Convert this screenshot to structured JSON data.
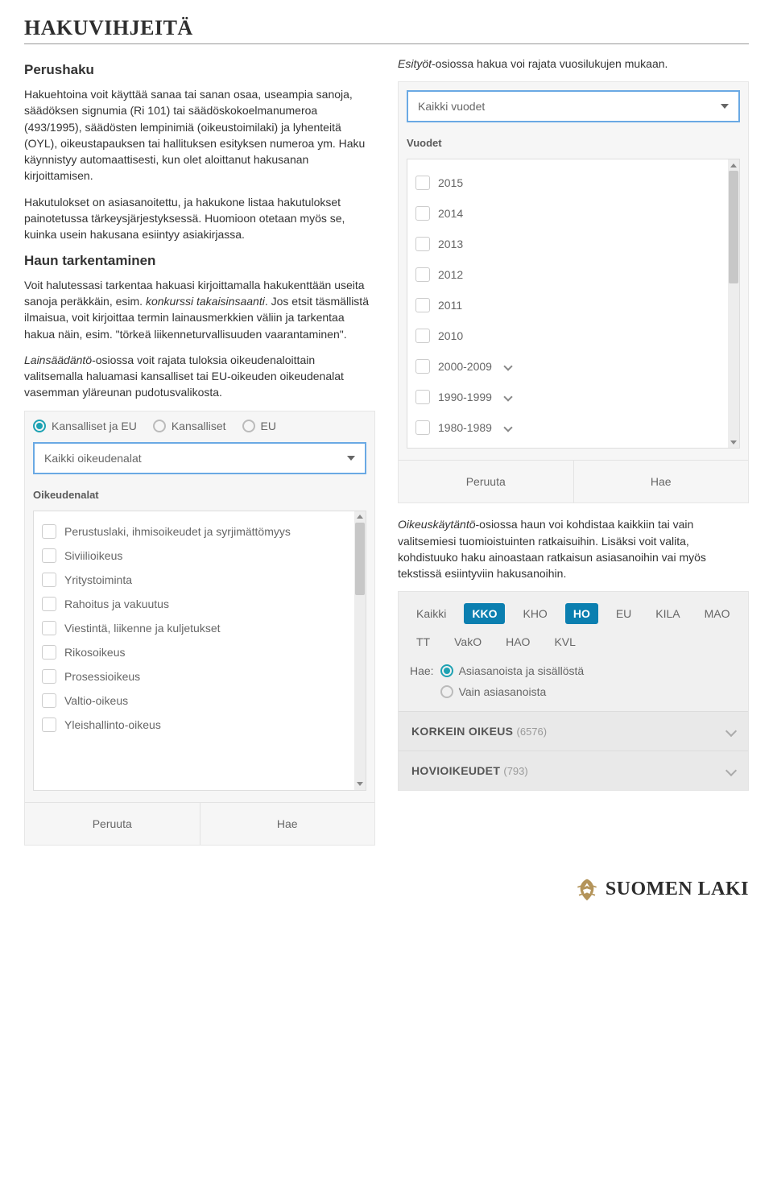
{
  "page_title": "HAKUVIHJEITÄ",
  "left": {
    "h_perushaku": "Perushaku",
    "p1": "Hakuehtoina voit käyttää sanaa tai sanan osaa, useampia sanoja, säädöksen signumia (Ri 101) tai säädöskokoelmanumeroa (493/1995), säädösten lempinimiä (oikeustoimilaki) ja lyhenteitä (OYL), oikeustapauksen tai hallituksen esityksen numeroa ym. Haku käynnistyy automaattisesti, kun olet aloittanut hakusanan kirjoittamisen.",
    "p2": "Hakutulokset on asiasanoitettu, ja hakukone listaa hakutulokset painotetussa tärkeysjärjestyksessä. Huomioon otetaan myös se, kuinka usein hakusana esiintyy asiakirjassa.",
    "h_tarkentaminen": "Haun tarkentaminen",
    "p3a": "Voit halutessasi tarkentaa hakuasi kirjoittamalla hakukenttään useita sanoja peräkkäin, esim. ",
    "p3b_italic": "konkurssi takaisinsaanti",
    "p3c": ". Jos etsit täsmällistä ilmaisua, voit kirjoittaa termin lainausmerkkien väliin ja tarkentaa hakua näin, esim. \"törkeä liikenneturvallisuuden vaarantaminen\".",
    "p4_italic": "Lainsäädäntö",
    "p4_rest": "-osiossa voit rajata tuloksia oikeudenaloittain valitsemalla haluamasi kansalliset tai EU-oikeuden oikeudenalat vasemman yläreunan pudotusvalikosta."
  },
  "right": {
    "p_esityot_italic": "Esityöt",
    "p_esityot_rest": "-osiossa hakua voi rajata vuosilukujen mukaan."
  },
  "year_panel": {
    "select_value": "Kaikki vuodet",
    "label": "Vuodet",
    "items": [
      "2015",
      "2014",
      "2013",
      "2012",
      "2011",
      "2010",
      "2000-2009",
      "1990-1999",
      "1980-1989"
    ],
    "expandable_from_index": 6,
    "cancel": "Peruuta",
    "search": "Hae"
  },
  "scope_panel": {
    "options": [
      "Kansalliset ja EU",
      "Kansalliset",
      "EU"
    ],
    "selected_index": 0,
    "select_value": "Kaikki oikeudenalat",
    "label": "Oikeudenalat",
    "items": [
      "Perustuslaki, ihmisoikeudet ja syrjimättömyys",
      "Siviilioikeus",
      "Yritystoiminta",
      "Rahoitus ja vakuutus",
      "Viestintä, liikenne ja kuljetukset",
      "Rikosoikeus",
      "Prosessioikeus",
      "Valtio-oikeus",
      "Yleishallinto-oikeus"
    ],
    "cancel": "Peruuta",
    "search": "Hae"
  },
  "oikeuskaytanto_text": {
    "italic": "Oikeuskäytäntö",
    "rest": "-osiossa haun voi kohdistaa kaikkiin tai vain valitsemiesi tuomioistuinten ratkaisuihin. Lisäksi voit valita, kohdistuuko haku ainoastaan ratkaisun asiasanoihin vai myös tekstissä esiintyviin hakusanoihin."
  },
  "court_panel": {
    "tabs": [
      "Kaikki",
      "KKO",
      "KHO",
      "HO",
      "EU",
      "KILA",
      "MAO",
      "TT",
      "VakO",
      "HAO",
      "KVL"
    ],
    "active_indices": [
      1,
      3
    ],
    "hae_label": "Hae:",
    "hae_options": [
      "Asiasanoista ja sisällöstä",
      "Vain asiasanoista"
    ],
    "hae_selected_index": 0,
    "accordion": [
      {
        "title": "KORKEIN OIKEUS",
        "count": "(6576)"
      },
      {
        "title": "HOVIOIKEUDET",
        "count": "(793)"
      }
    ]
  },
  "logo_text": "SUOMEN LAKI"
}
